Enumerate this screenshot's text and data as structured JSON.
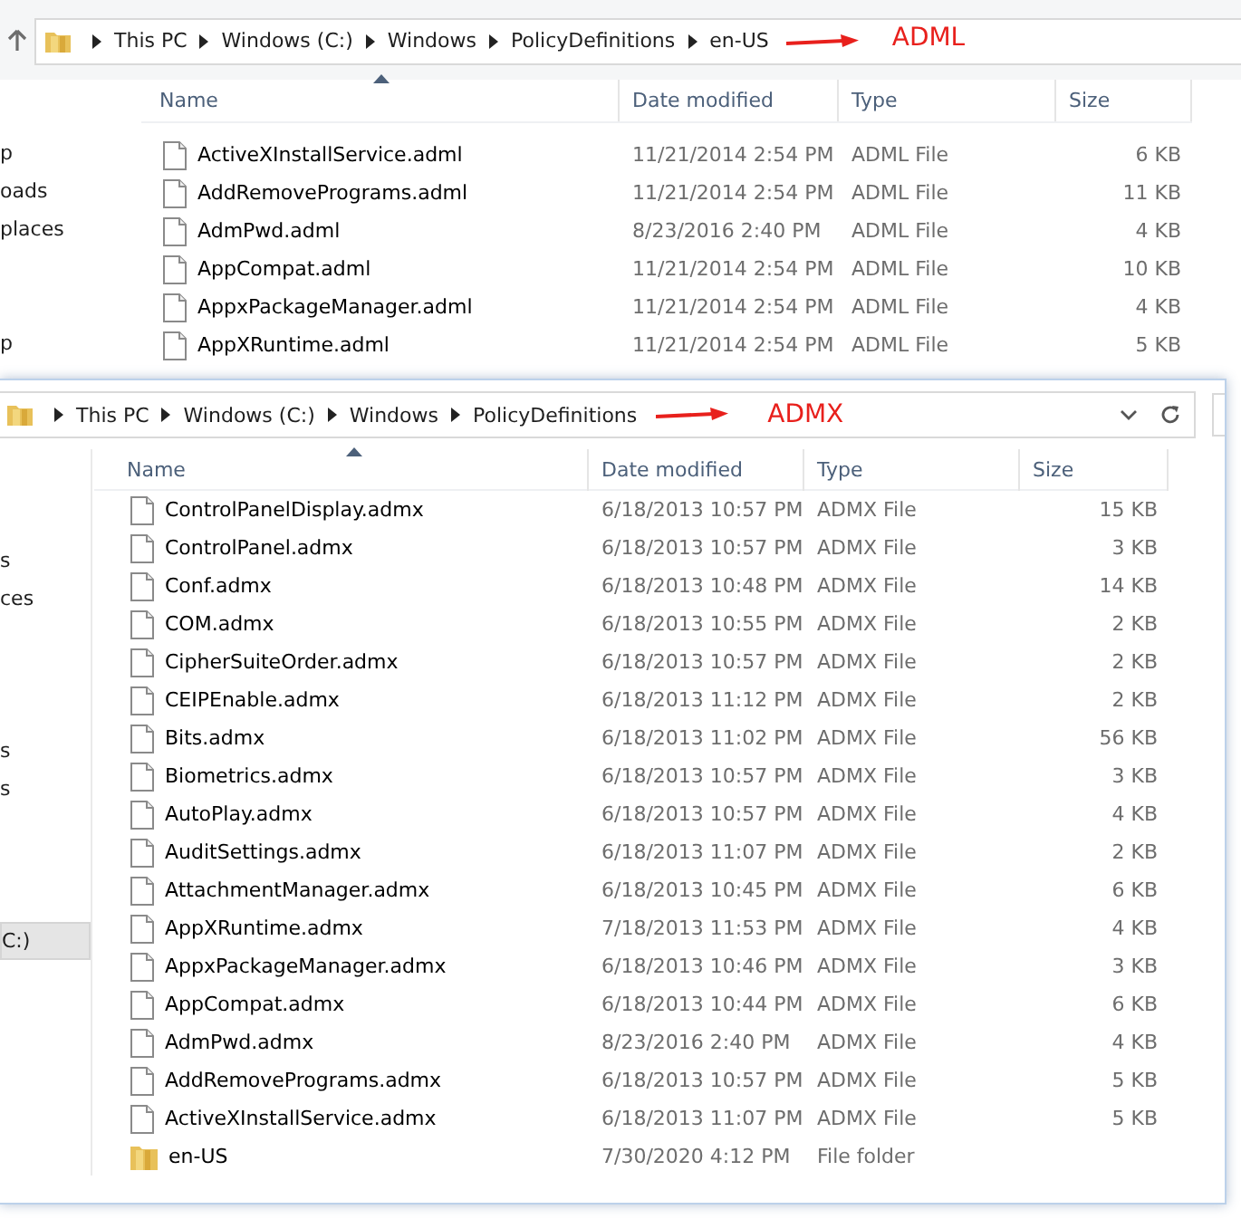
{
  "windows": [
    {
      "address": {
        "crumbs": [
          "This PC",
          "Windows (C:)",
          "Windows",
          "PolicyDefinitions",
          "en-US"
        ],
        "annotation": "ADML"
      },
      "sidebar": [
        {
          "label": "p",
          "selected": false
        },
        {
          "label": "oads",
          "selected": false
        },
        {
          "label": "places",
          "selected": false
        },
        {
          "label": "p",
          "selected": false
        }
      ],
      "columns": [
        "Name",
        "Date modified",
        "Type",
        "Size"
      ],
      "rows": [
        {
          "kind": "file",
          "name": "ActiveXInstallService.adml",
          "date": "11/21/2014 2:54 PM",
          "type": "ADML File",
          "size": "6 KB"
        },
        {
          "kind": "file",
          "name": "AddRemovePrograms.adml",
          "date": "11/21/2014 2:54 PM",
          "type": "ADML File",
          "size": "11 KB"
        },
        {
          "kind": "file",
          "name": "AdmPwd.adml",
          "date": "8/23/2016 2:40 PM",
          "type": "ADML File",
          "size": "4 KB"
        },
        {
          "kind": "file",
          "name": "AppCompat.adml",
          "date": "11/21/2014 2:54 PM",
          "type": "ADML File",
          "size": "10 KB"
        },
        {
          "kind": "file",
          "name": "AppxPackageManager.adml",
          "date": "11/21/2014 2:54 PM",
          "type": "ADML File",
          "size": "4 KB"
        },
        {
          "kind": "file",
          "name": "AppXRuntime.adml",
          "date": "11/21/2014 2:54 PM",
          "type": "ADML File",
          "size": "5 KB"
        }
      ]
    },
    {
      "address": {
        "crumbs": [
          "This PC",
          "Windows (C:)",
          "Windows",
          "PolicyDefinitions"
        ],
        "annotation": "ADMX"
      },
      "sidebar": [
        {
          "label": "s",
          "selected": false
        },
        {
          "label": "ces",
          "selected": false
        },
        {
          "label": "s",
          "selected": false
        },
        {
          "label": "s",
          "selected": false
        },
        {
          "label": "C:)",
          "selected": true
        }
      ],
      "columns": [
        "Name",
        "Date modified",
        "Type",
        "Size"
      ],
      "rows": [
        {
          "kind": "file",
          "name": "ControlPanelDisplay.admx",
          "date": "6/18/2013 10:57 PM",
          "type": "ADMX File",
          "size": "15 KB"
        },
        {
          "kind": "file",
          "name": "ControlPanel.admx",
          "date": "6/18/2013 10:57 PM",
          "type": "ADMX File",
          "size": "3 KB"
        },
        {
          "kind": "file",
          "name": "Conf.admx",
          "date": "6/18/2013 10:48 PM",
          "type": "ADMX File",
          "size": "14 KB"
        },
        {
          "kind": "file",
          "name": "COM.admx",
          "date": "6/18/2013 10:55 PM",
          "type": "ADMX File",
          "size": "2 KB"
        },
        {
          "kind": "file",
          "name": "CipherSuiteOrder.admx",
          "date": "6/18/2013 10:57 PM",
          "type": "ADMX File",
          "size": "2 KB"
        },
        {
          "kind": "file",
          "name": "CEIPEnable.admx",
          "date": "6/18/2013 11:12 PM",
          "type": "ADMX File",
          "size": "2 KB"
        },
        {
          "kind": "file",
          "name": "Bits.admx",
          "date": "6/18/2013 11:02 PM",
          "type": "ADMX File",
          "size": "56 KB"
        },
        {
          "kind": "file",
          "name": "Biometrics.admx",
          "date": "6/18/2013 10:57 PM",
          "type": "ADMX File",
          "size": "3 KB"
        },
        {
          "kind": "file",
          "name": "AutoPlay.admx",
          "date": "6/18/2013 10:57 PM",
          "type": "ADMX File",
          "size": "4 KB"
        },
        {
          "kind": "file",
          "name": "AuditSettings.admx",
          "date": "6/18/2013 11:07 PM",
          "type": "ADMX File",
          "size": "2 KB"
        },
        {
          "kind": "file",
          "name": "AttachmentManager.admx",
          "date": "6/18/2013 10:45 PM",
          "type": "ADMX File",
          "size": "6 KB"
        },
        {
          "kind": "file",
          "name": "AppXRuntime.admx",
          "date": "7/18/2013 11:53 PM",
          "type": "ADMX File",
          "size": "4 KB"
        },
        {
          "kind": "file",
          "name": "AppxPackageManager.admx",
          "date": "6/18/2013 10:46 PM",
          "type": "ADMX File",
          "size": "3 KB"
        },
        {
          "kind": "file",
          "name": "AppCompat.admx",
          "date": "6/18/2013 10:44 PM",
          "type": "ADMX File",
          "size": "6 KB"
        },
        {
          "kind": "file",
          "name": "AdmPwd.admx",
          "date": "8/23/2016 2:40 PM",
          "type": "ADMX File",
          "size": "4 KB"
        },
        {
          "kind": "file",
          "name": "AddRemovePrograms.admx",
          "date": "6/18/2013 10:57 PM",
          "type": "ADMX File",
          "size": "5 KB"
        },
        {
          "kind": "file",
          "name": "ActiveXInstallService.admx",
          "date": "6/18/2013 11:07 PM",
          "type": "ADMX File",
          "size": "5 KB"
        },
        {
          "kind": "folder",
          "name": "en-US",
          "date": "7/30/2020 4:12 PM",
          "type": "File folder",
          "size": ""
        }
      ]
    }
  ]
}
